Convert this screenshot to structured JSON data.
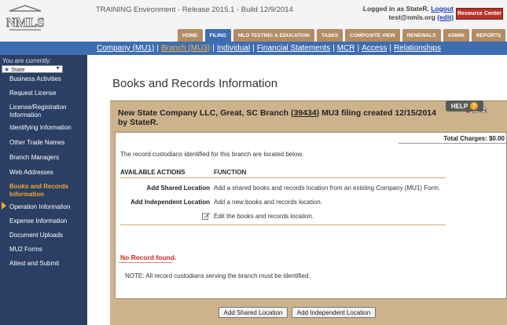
{
  "header": {
    "logo_text": "NMLS",
    "env_title": "TRAINING Environment - Release 2015.1 - Build 12/9/2014",
    "login_prefix": "Logged in as StateR.",
    "logout_label": "Logout",
    "email": "test@nmls.org",
    "edit_label": "(edit)",
    "resource_center": "Resource Center"
  },
  "topnav": [
    "HOME",
    "FILING",
    "MLO TESTING & EDUCATION",
    "TASKS",
    "COMPOSITE VIEW",
    "RENEWALS",
    "ADMIN",
    "REPORTS"
  ],
  "subnav": [
    "Company (MU1)",
    "Branch (MU3)",
    "Individual",
    "Financial Statements",
    "MCR",
    "Access",
    "Relationships"
  ],
  "sidebar": {
    "you_are": "You are currently:",
    "state_value": "State",
    "items": [
      "Business Activities",
      "Request License",
      "License/Registration Information",
      "Identifying Information",
      "Other Trade Names",
      "Branch Managers",
      "Web Addresses",
      "Books and Records Information",
      "Operation Information",
      "Expense Information",
      "Document Uploads",
      "MU2 Forms",
      "Attest and Submit"
    ]
  },
  "main": {
    "page_title": "Books and Records Information",
    "help_label": "HELP",
    "panel_title_pre": "New State Company LLC, Great, SC Branch (",
    "panel_title_link": "39434",
    "panel_title_post": ") MU3 filing created 12/15/2014 by StateR.",
    "total_charges": "Total Charges: $0.00",
    "intro": "The record custodians identified for this branch are located below.",
    "table": {
      "col_action": "AVAILABLE ACTIONS",
      "col_function": "FUNCTION",
      "rows": [
        {
          "action": "Add Shared Location",
          "function": "Add a shared books and records location from an existing Company (MU1) Form."
        },
        {
          "action": "Add Independent Location",
          "function": "Add a new books and records location."
        },
        {
          "action": "",
          "function": "Edit the books and records location."
        }
      ]
    },
    "no_record": "No Record found.",
    "note": "NOTE: All record custodians serving the branch must be identified.",
    "buttons": {
      "shared": "Add Shared Location",
      "independent": "Add Independent Location"
    }
  },
  "colors": {
    "nav_blue": "#3e6db0",
    "sidebar_bg": "#2a3f63",
    "panel_tan": "#cdb38c",
    "active_orange": "#f6a63a",
    "error_red": "#d42020"
  }
}
